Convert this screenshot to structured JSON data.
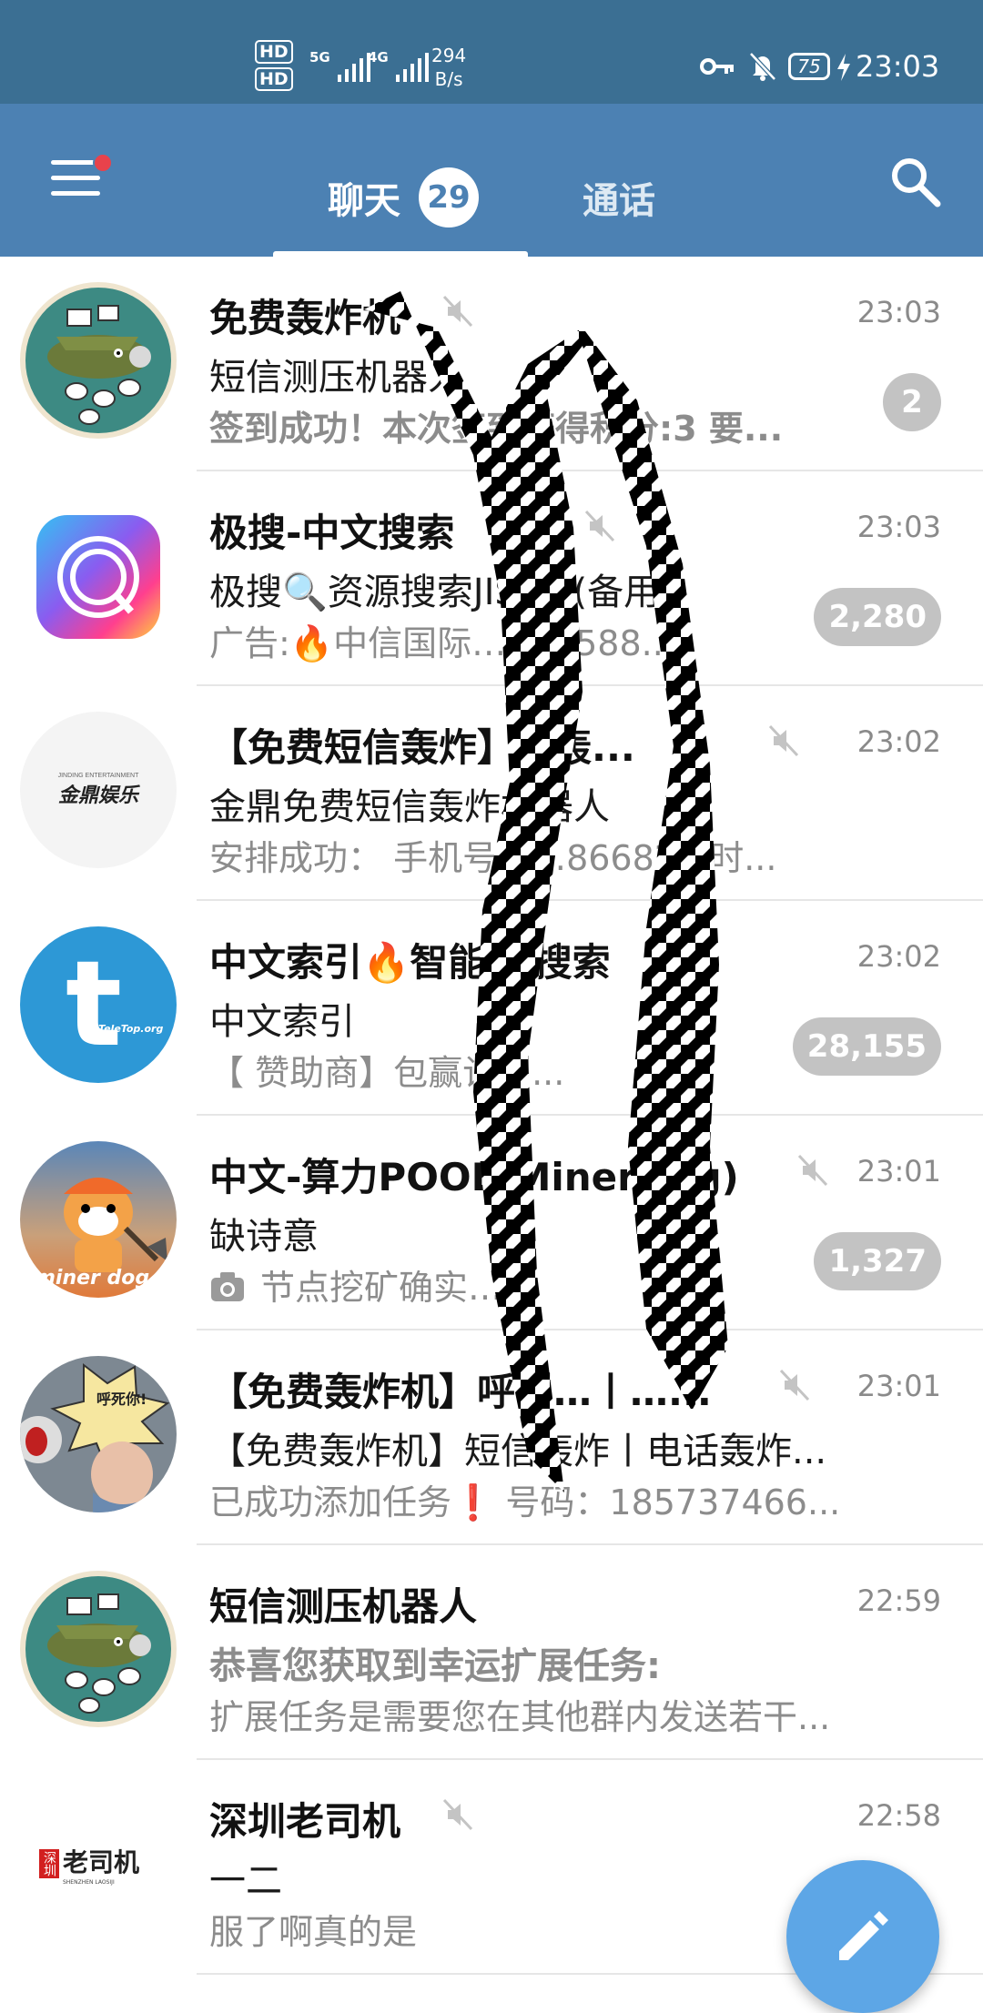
{
  "status_bar": {
    "hd1": "HD",
    "hd2": "HD",
    "net1": "5G",
    "net2": "4G",
    "speed_value": "294",
    "speed_unit": "B/s",
    "battery": "75",
    "time": "23:03"
  },
  "header": {
    "tab_chats_label": "聊天",
    "tab_chats_count": "29",
    "tab_calls_label": "通话",
    "accent": "#4c81b3",
    "status_color": "#3b6f93"
  },
  "chats": [
    {
      "title": "免费轰炸机",
      "muted": true,
      "time": "23:03",
      "line2": "短信测压机器人",
      "line3": "签到成功！本次签到获得积分:3 要...",
      "unread": "2"
    },
    {
      "title": "极搜-中文搜索",
      "muted": true,
      "time": "23:03",
      "line2": "极搜🔍资源搜索JISOU(备用)",
      "line3": "广告:🔥中信国际…支持588...",
      "unread": "2,280"
    },
    {
      "title": "【免费短信轰炸】…轰...",
      "muted": true,
      "time": "23:02",
      "line2": "金鼎免费短信轰炸机器人",
      "line3": "安排成功： 手机号：…866821 时...",
      "unread": ""
    },
    {
      "title": "中文索引🔥智能🔥搜索",
      "muted": false,
      "time": "23:02",
      "line2": "中文索引",
      "line3": "【 赞助商】包赢计划...",
      "unread": "28,155"
    },
    {
      "title": "中文-算力POOL(MinerDog)",
      "muted": true,
      "time": "23:01",
      "line2": "缺诗意",
      "line3": "节点挖矿确实…",
      "unread": "1,327"
    },
    {
      "title": "【免费轰炸机】呼叫…丨…...",
      "muted": true,
      "time": "23:01",
      "line2": "【免费轰炸机】短信轰炸丨电话轰炸...",
      "line3": "已成功添加任务❗ 号码：185737466...",
      "unread": ""
    },
    {
      "title": "短信测压机器人",
      "muted": false,
      "time": "22:59",
      "line2": "恭喜您获取到幸运扩展任务:",
      "line3": "扩展任务是需要您在其他群内发送若干...",
      "unread": ""
    },
    {
      "title": "深圳老司机",
      "muted": true,
      "time": "22:58",
      "line2": "一二",
      "line3": "服了啊真的是",
      "unread": ""
    }
  ],
  "avatar_text": {
    "jinding": "金鼎娱乐",
    "jinding_small": "JINDING ENTERTAINMENT",
    "teletop": "TeleTop.org",
    "minerdog": "miner dog",
    "shout": "呼死你!",
    "laosiji_main": "老司机",
    "laosiji_side": "深圳",
    "laosiji_en": "SHENZHEN LAOSIJI"
  },
  "icons": {
    "menu": "hamburger-icon",
    "search": "search-icon",
    "mute": "muted-speaker-icon",
    "compose": "pencil-icon",
    "camera": "camera-icon"
  }
}
